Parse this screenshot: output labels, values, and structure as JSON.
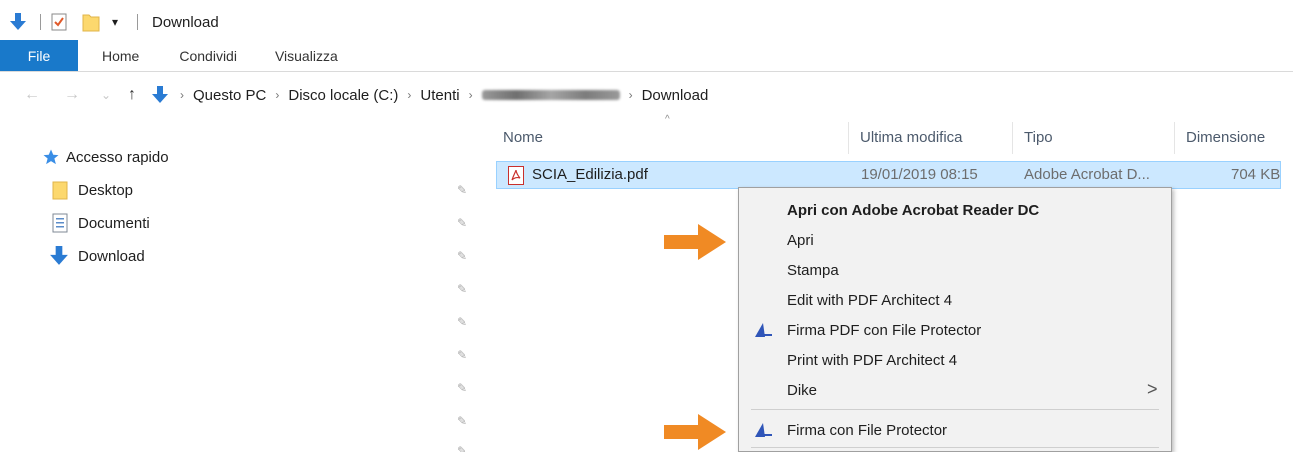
{
  "window": {
    "title": "Download",
    "quick_access_icons": [
      "download-arrow-icon",
      "properties-checklist-icon",
      "new-folder-icon",
      "customize-dropdown-icon"
    ],
    "customize_glyph": "▾"
  },
  "ribbon": {
    "tabs": [
      {
        "label": "File",
        "active": true
      },
      {
        "label": "Home"
      },
      {
        "label": "Condividi"
      },
      {
        "label": "Visualizza"
      }
    ],
    "accent_color": "#1979ca"
  },
  "address_bar": {
    "nav_glyphs": {
      "back": "←",
      "forward": "→",
      "recent": "⌄",
      "up": "↑"
    },
    "breadcrumb": [
      "Questo PC",
      "Disco locale (C:)",
      "Utenti",
      "",
      "Download"
    ],
    "separator": "›"
  },
  "navigation_pane": {
    "quick_access_label": "Accesso rapido",
    "items": [
      {
        "label": "Desktop",
        "icon": "folder-icon",
        "pinned": true
      },
      {
        "label": "Documenti",
        "icon": "document-icon",
        "pinned": true
      },
      {
        "label": "Download",
        "icon": "download-arrow-icon",
        "pinned": true
      }
    ],
    "pin_glyph": "📌"
  },
  "file_list": {
    "columns": [
      "Nome",
      "Ultima modifica",
      "Tipo",
      "Dimensione"
    ],
    "sort_glyph": "^",
    "rows": [
      {
        "name": "SCIA_Edilizia.pdf",
        "modified": "19/01/2019 08:15",
        "type": "Adobe Acrobat D...",
        "size": "704 KB",
        "selected": true,
        "icon": "pdf-file-icon"
      }
    ],
    "selection_color": "#cce8ff"
  },
  "context_menu": {
    "items": [
      {
        "label": "Apri con Adobe Acrobat Reader DC",
        "bold": true
      },
      {
        "label": "Apri"
      },
      {
        "label": "Stampa"
      },
      {
        "label": "Edit with PDF Architect 4"
      },
      {
        "label": "Firma PDF con File Protector",
        "icon": "file-protector-icon"
      },
      {
        "label": "Print with PDF Architect 4"
      },
      {
        "label": "Dike",
        "submenu": true,
        "submenu_glyph": ">"
      },
      {
        "label": "Firma con File Protector",
        "icon": "file-protector-icon"
      }
    ]
  },
  "annotations": {
    "arrow_color": "#f08a24",
    "arrows": [
      "orange-arrow-icon",
      "orange-arrow-icon"
    ]
  }
}
